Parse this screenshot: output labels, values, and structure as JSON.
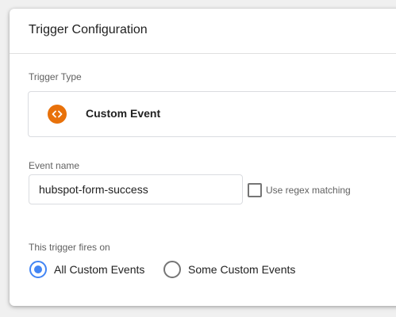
{
  "card": {
    "title": "Trigger Configuration"
  },
  "trigger_type": {
    "label": "Trigger Type",
    "name": "Custom Event",
    "icon": "code-brackets-icon",
    "icon_color": "#e8710a"
  },
  "event_name": {
    "label": "Event name",
    "value": "hubspot-form-success",
    "regex_label": "Use regex matching",
    "regex_checked": false
  },
  "fires_on": {
    "label": "This trigger fires on",
    "options": [
      {
        "label": "All Custom Events",
        "selected": true
      },
      {
        "label": "Some Custom Events",
        "selected": false
      }
    ],
    "accent": "#4285f4"
  }
}
